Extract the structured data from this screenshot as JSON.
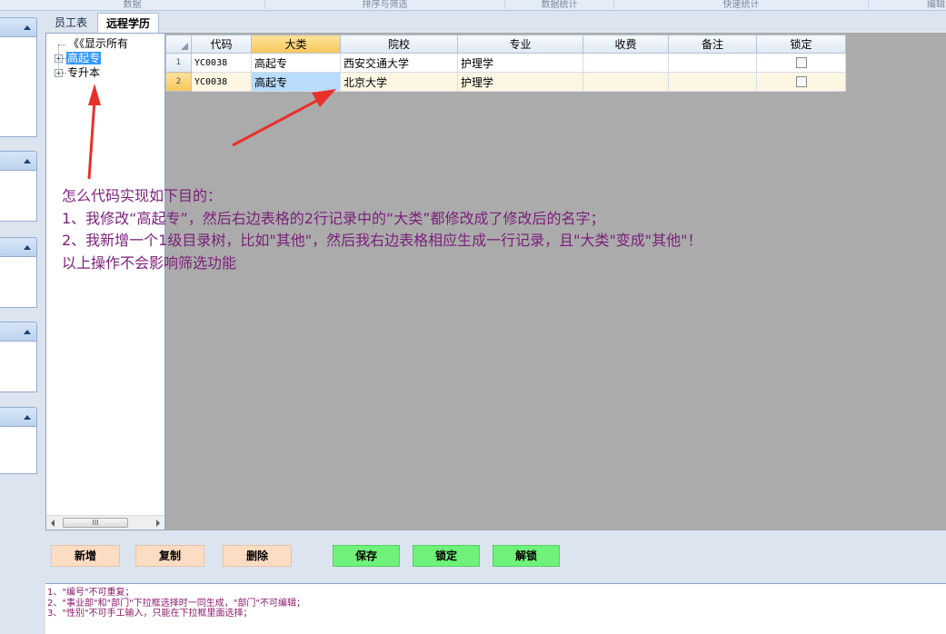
{
  "ribbon": {
    "groups": [
      "数据",
      "排序与筛选",
      "数据统计",
      "快速统计",
      "编辑"
    ]
  },
  "tabs": [
    {
      "label": "员工表",
      "active": false
    },
    {
      "label": "远程学历",
      "active": true
    }
  ],
  "tree": {
    "root_label": "《《显示所有",
    "nodes": [
      {
        "label": "高起专",
        "selected": true
      },
      {
        "label": "专升本",
        "selected": false
      }
    ],
    "scroll_thumb": "III"
  },
  "grid": {
    "columns": [
      "代码",
      "大类",
      "院校",
      "专业",
      "收费",
      "备注",
      "锁定"
    ],
    "rows": [
      {
        "num": "1",
        "code": "YC0038",
        "category": "高起专",
        "school": "西安交通大学",
        "major": "护理学",
        "fee": "",
        "remark": "",
        "locked": false
      },
      {
        "num": "2",
        "code": "YC0038",
        "category": "高起专",
        "school": "北京大学",
        "major": "护理学",
        "fee": "",
        "remark": "",
        "locked": false
      }
    ]
  },
  "annotation": {
    "lines": [
      "怎么代码实现如下目的：",
      "1、我修改“高起专”，然后右边表格的2行记录中的“大类”都修改成了修改后的名字；",
      "2、我新增一个1级目录树，比如\"其他\"，然后我右边表格相应生成一行记录，且\"大类\"变成\"其他\"！",
      "以上操作不会影响筛选功能"
    ],
    "color": "#7a1f7a",
    "arrow_color": "#e8312a"
  },
  "buttons": {
    "add": "新增",
    "copy": "复制",
    "delete": "删除",
    "save": "保存",
    "lock": "锁定",
    "unlock": "解锁"
  },
  "notes": [
    "1、\"编号\"不可重复；",
    "2、\"事业部\"和\"部门\"下拉框选择时一同生成，\"部门\"不可编辑；",
    "3、\"性别\"不可手工输入，只能在下拉框里面选择；"
  ]
}
